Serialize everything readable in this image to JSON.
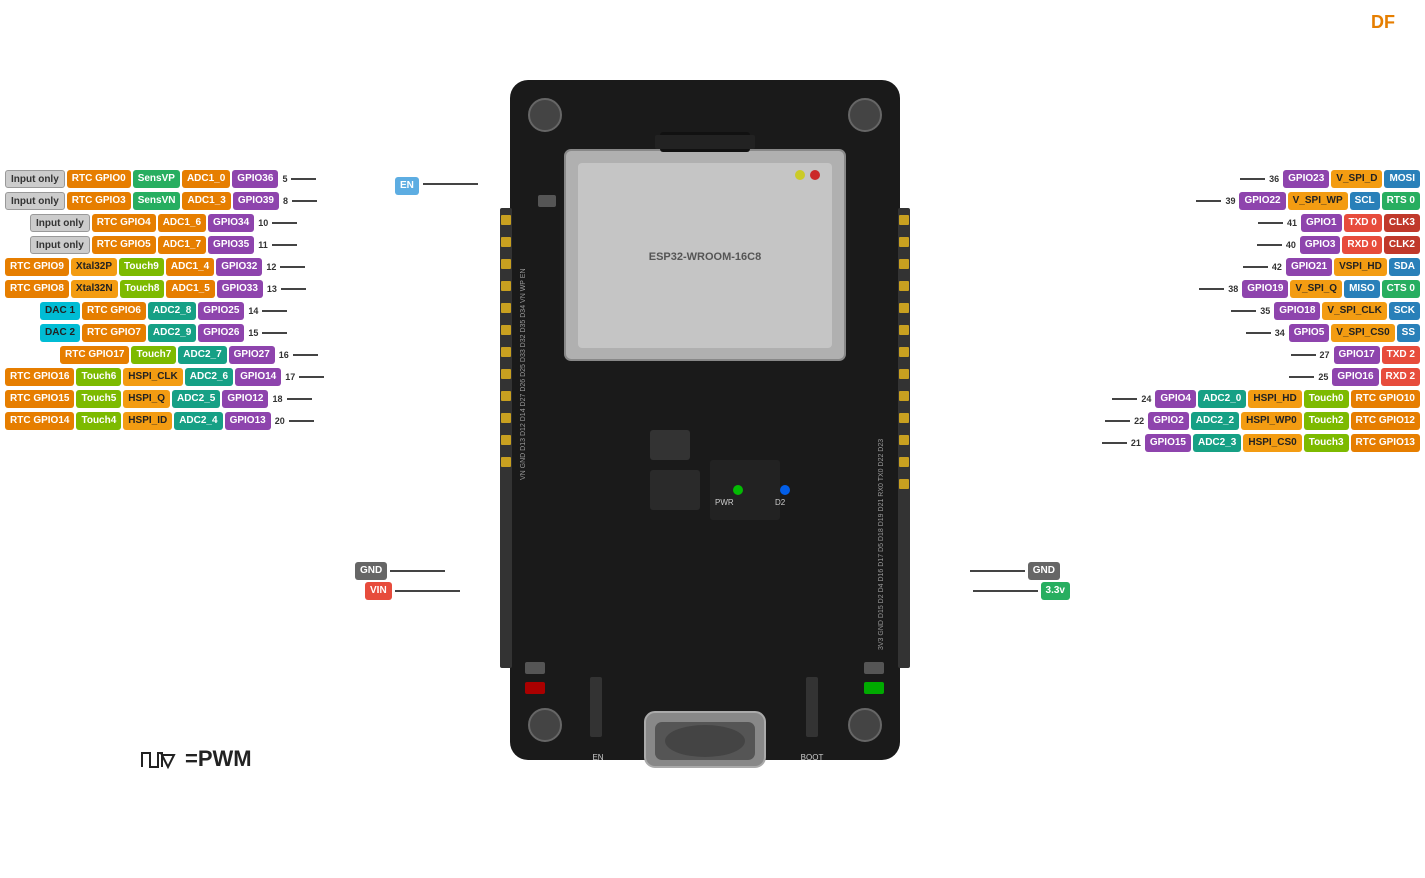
{
  "logo": "DF",
  "pwm_legend": "=PWM",
  "board": {
    "en_label": "EN",
    "gnd_left": "GND",
    "vin_label": "VIN",
    "gnd_right": "GND",
    "v33_label": "3.3v",
    "pwr_label": "PWR",
    "d2_label": "D2"
  },
  "left_pins": [
    {
      "row": 1,
      "num": "5",
      "gpio": "GPIO36",
      "gpio_color": "purple",
      "adc": "ADC1_0",
      "adc_color": "orange",
      "extra1": "SensVP",
      "extra1_color": "green",
      "extra2": "RTC GPIO0",
      "extra2_color": "orange",
      "input_only": "Input only"
    },
    {
      "row": 2,
      "num": "8",
      "gpio": "GPIO39",
      "gpio_color": "purple",
      "adc": "ADC1_3",
      "adc_color": "orange",
      "extra1": "SensVN",
      "extra1_color": "green",
      "extra2": "RTC GPIO3",
      "extra2_color": "orange",
      "input_only": "Input only"
    },
    {
      "row": 3,
      "num": "10",
      "gpio": "GPIO34",
      "gpio_color": "purple",
      "adc": "ADC1_6",
      "adc_color": "orange",
      "extra1": "RTC GPIO4",
      "extra1_color": "orange",
      "input_only": "Input only"
    },
    {
      "row": 4,
      "num": "11",
      "gpio": "GPIO35",
      "gpio_color": "purple",
      "adc": "ADC1_7",
      "adc_color": "orange",
      "extra1": "RTC GPIO5",
      "extra1_color": "orange",
      "input_only": "Input only"
    },
    {
      "row": 5,
      "num": "12",
      "gpio": "GPIO32",
      "gpio_color": "purple",
      "adc": "ADC1_4",
      "adc_color": "orange",
      "extra1": "Touch9",
      "extra1_color": "lime",
      "extra2": "Xtal32P",
      "extra2_color": "yellow",
      "extra3": "RTC GPIO9",
      "extra3_color": "orange"
    },
    {
      "row": 6,
      "num": "13",
      "gpio": "GPIO33",
      "gpio_color": "purple",
      "adc": "ADC1_5",
      "adc_color": "orange",
      "extra1": "Touch8",
      "extra1_color": "lime",
      "extra2": "Xtal32N",
      "extra2_color": "yellow",
      "extra3": "RTC GPIO8",
      "extra3_color": "orange"
    },
    {
      "row": 7,
      "num": "14",
      "gpio": "GPIO25",
      "gpio_color": "purple",
      "adc": "ADC2_8",
      "adc_color": "teal",
      "extra1": "RTC GPIO6",
      "extra1_color": "orange",
      "extra2": "DAC 1",
      "extra2_color": "cyan"
    },
    {
      "row": 8,
      "num": "15",
      "gpio": "GPIO26",
      "gpio_color": "purple",
      "adc": "ADC2_9",
      "adc_color": "teal",
      "extra1": "RTC GPIO7",
      "extra1_color": "orange",
      "extra2": "DAC 2",
      "extra2_color": "cyan"
    },
    {
      "row": 9,
      "num": "16",
      "gpio": "GPIO27",
      "gpio_color": "purple",
      "adc": "ADC2_7",
      "adc_color": "teal",
      "extra1": "Touch7",
      "extra1_color": "lime",
      "extra2": "RTC GPIO17",
      "extra2_color": "orange"
    },
    {
      "row": 10,
      "num": "17",
      "gpio": "GPIO14",
      "gpio_color": "purple",
      "adc": "ADC2_6",
      "adc_color": "teal",
      "extra1": "HSPI_CLK",
      "extra1_color": "yellow",
      "extra2": "Touch6",
      "extra2_color": "lime",
      "extra3": "RTC GPIO16",
      "extra3_color": "orange"
    },
    {
      "row": 11,
      "num": "18",
      "gpio": "GPIO12",
      "gpio_color": "purple",
      "adc": "ADC2_5",
      "adc_color": "teal",
      "extra1": "HSPI_Q",
      "extra1_color": "yellow",
      "extra2": "Touch5",
      "extra2_color": "lime",
      "extra3": "RTC GPIO15",
      "extra3_color": "orange"
    },
    {
      "row": 12,
      "num": "20",
      "gpio": "GPIO13",
      "gpio_color": "purple",
      "adc": "ADC2_4",
      "adc_color": "teal",
      "extra1": "HSPI_ID",
      "extra1_color": "yellow",
      "extra2": "Touch4",
      "extra2_color": "lime",
      "extra3": "RTC GPIO14",
      "extra3_color": "orange"
    }
  ],
  "right_pins": [
    {
      "row": 1,
      "num": "36",
      "gpio": "GPIO23",
      "gpio_color": "purple",
      "extra1": "V_SPI_D",
      "extra1_color": "yellow",
      "extra2": "MOSI",
      "extra2_color": "blue"
    },
    {
      "row": 2,
      "num": "39",
      "gpio": "GPIO22",
      "gpio_color": "purple",
      "extra1": "V_SPI_WP",
      "extra1_color": "yellow",
      "extra2": "SCL",
      "extra2_color": "blue",
      "extra3": "RTS 0",
      "extra3_color": "green"
    },
    {
      "row": 3,
      "num": "41",
      "gpio": "GPIO1",
      "gpio_color": "purple",
      "extra1": "TXD 0",
      "extra1_color": "red",
      "extra2": "CLK3",
      "extra2_color": "magenta"
    },
    {
      "row": 4,
      "num": "40",
      "gpio": "GPIO3",
      "gpio_color": "purple",
      "extra1": "RXD 0",
      "extra1_color": "red",
      "extra2": "CLK2",
      "extra2_color": "magenta"
    },
    {
      "row": 5,
      "num": "42",
      "gpio": "GPIO21",
      "gpio_color": "purple",
      "extra1": "VSPI_HD",
      "extra1_color": "yellow",
      "extra2": "SDA",
      "extra2_color": "blue"
    },
    {
      "row": 6,
      "num": "38",
      "gpio": "GPIO19",
      "gpio_color": "purple",
      "extra1": "V_SPI_Q",
      "extra1_color": "yellow",
      "extra2": "MISO",
      "extra2_color": "blue",
      "extra3": "CTS 0",
      "extra3_color": "green"
    },
    {
      "row": 7,
      "num": "35",
      "gpio": "GPIO18",
      "gpio_color": "purple",
      "extra1": "V_SPI_CLK",
      "extra1_color": "yellow",
      "extra2": "SCK",
      "extra2_color": "blue"
    },
    {
      "row": 8,
      "num": "34",
      "gpio": "GPIO5",
      "gpio_color": "purple",
      "extra1": "V_SPI_CS0",
      "extra1_color": "yellow",
      "extra2": "SS",
      "extra2_color": "blue"
    },
    {
      "row": 9,
      "num": "27",
      "gpio": "GPIO17",
      "gpio_color": "purple",
      "extra1": "TXD 2",
      "extra1_color": "red"
    },
    {
      "row": 10,
      "num": "25",
      "gpio": "GPIO16",
      "gpio_color": "purple",
      "extra1": "RXD 2",
      "extra1_color": "red"
    },
    {
      "row": 11,
      "num": "24",
      "gpio": "GPIO4",
      "gpio_color": "purple",
      "extra1": "ADC2_0",
      "extra1_color": "teal",
      "extra2": "HSPI_HD",
      "extra2_color": "yellow",
      "extra3": "Touch0",
      "extra3_color": "lime",
      "extra4": "RTC GPIO10",
      "extra4_color": "orange"
    },
    {
      "row": 12,
      "num": "22",
      "gpio": "GPIO2",
      "gpio_color": "purple",
      "extra1": "ADC2_2",
      "extra1_color": "teal",
      "extra2": "HSPI_WP0",
      "extra2_color": "yellow",
      "extra3": "Touch2",
      "extra3_color": "lime",
      "extra4": "RTC GPIO12",
      "extra4_color": "orange"
    },
    {
      "row": 13,
      "num": "21",
      "gpio": "GPIO15",
      "gpio_color": "purple",
      "extra1": "ADC2_3",
      "extra1_color": "teal",
      "extra2": "HSPI_CS0",
      "extra2_color": "yellow",
      "extra3": "Touch3",
      "extra3_color": "lime",
      "extra4": "RTC GPIO13",
      "extra4_color": "orange"
    }
  ]
}
